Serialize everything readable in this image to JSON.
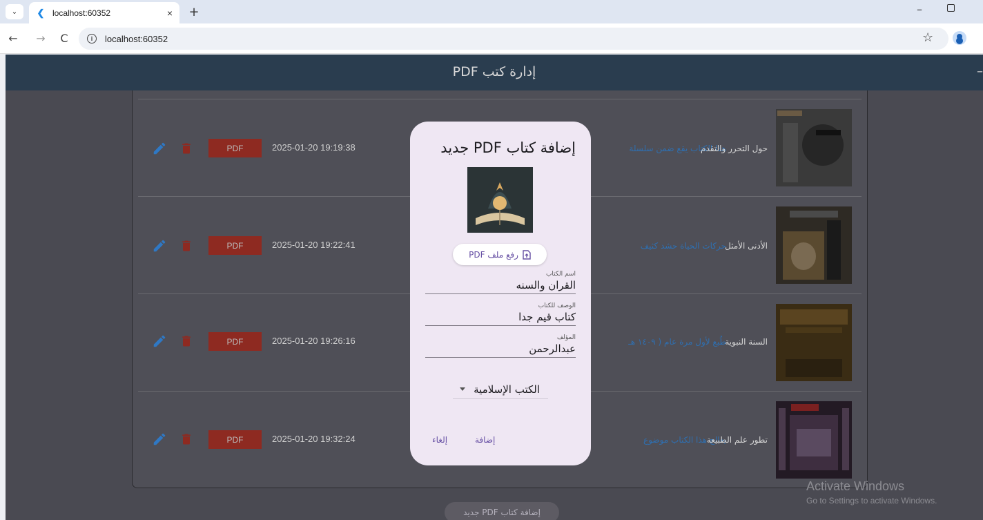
{
  "browser": {
    "tab_title": "localhost:60352",
    "tab_close": "×",
    "new_tab": "+",
    "url": "localhost:60352",
    "minimize": "–",
    "back": "←",
    "forward": "→",
    "reload": "C",
    "star": "☆",
    "dropdown": "⌄"
  },
  "app": {
    "title": "إدارة كتب PDF",
    "appbar_edge": "–",
    "add_button": "إضافة كتاب PDF جديد"
  },
  "books": [
    {
      "title": "حول التحرر والتقدم",
      "description": "هذا الكتاب يقع ضمن سلسلة",
      "date": "2025-01-20 19:19:38",
      "pdf_label": "PDF",
      "cover_color": "#3a3a3a"
    },
    {
      "title": "الأدنى الأمثل",
      "description": "حركات الحياة حشد كثيف",
      "date": "2025-01-20 19:22:41",
      "pdf_label": "PDF",
      "cover_color": "#2e2a24"
    },
    {
      "title": "السنة النبوية",
      "description": "طُبع لأول مرة عام ( ١٤٠٩ هـ",
      "date": "2025-01-20 19:26:16",
      "pdf_label": "PDF",
      "cover_color": "#3a2c14"
    },
    {
      "title": "تطور علم الطبيعة",
      "description": "يعالج هذا الكتاب موضوع",
      "date": "2025-01-20 19:32:24",
      "pdf_label": "PDF",
      "cover_color": "#231a24"
    }
  ],
  "dialog": {
    "title": "إضافة كتاب PDF جديد",
    "upload_label": "رفع ملف PDF",
    "fields": {
      "name_label": "اسم الكتاب",
      "name_value": "القران والسنه",
      "desc_label": "الوصف للكتاب",
      "desc_value": "كتاب قيم جدا",
      "author_label": "المؤلف",
      "author_value": "عبدالرحمن"
    },
    "category": "الكتب الإسلامية",
    "add_label": "إضافة",
    "cancel_label": "إلغاء"
  },
  "watermark": {
    "line1": "Activate Windows",
    "line2": "Go to Settings to activate Windows."
  },
  "colors": {
    "appbar": "#2a3d4f",
    "overlay": "#4a4a52",
    "pdf_button": "#8e2a21",
    "icon_blue": "#2f78c4",
    "dialog": "#efe7f3",
    "accent": "#6750a4"
  }
}
